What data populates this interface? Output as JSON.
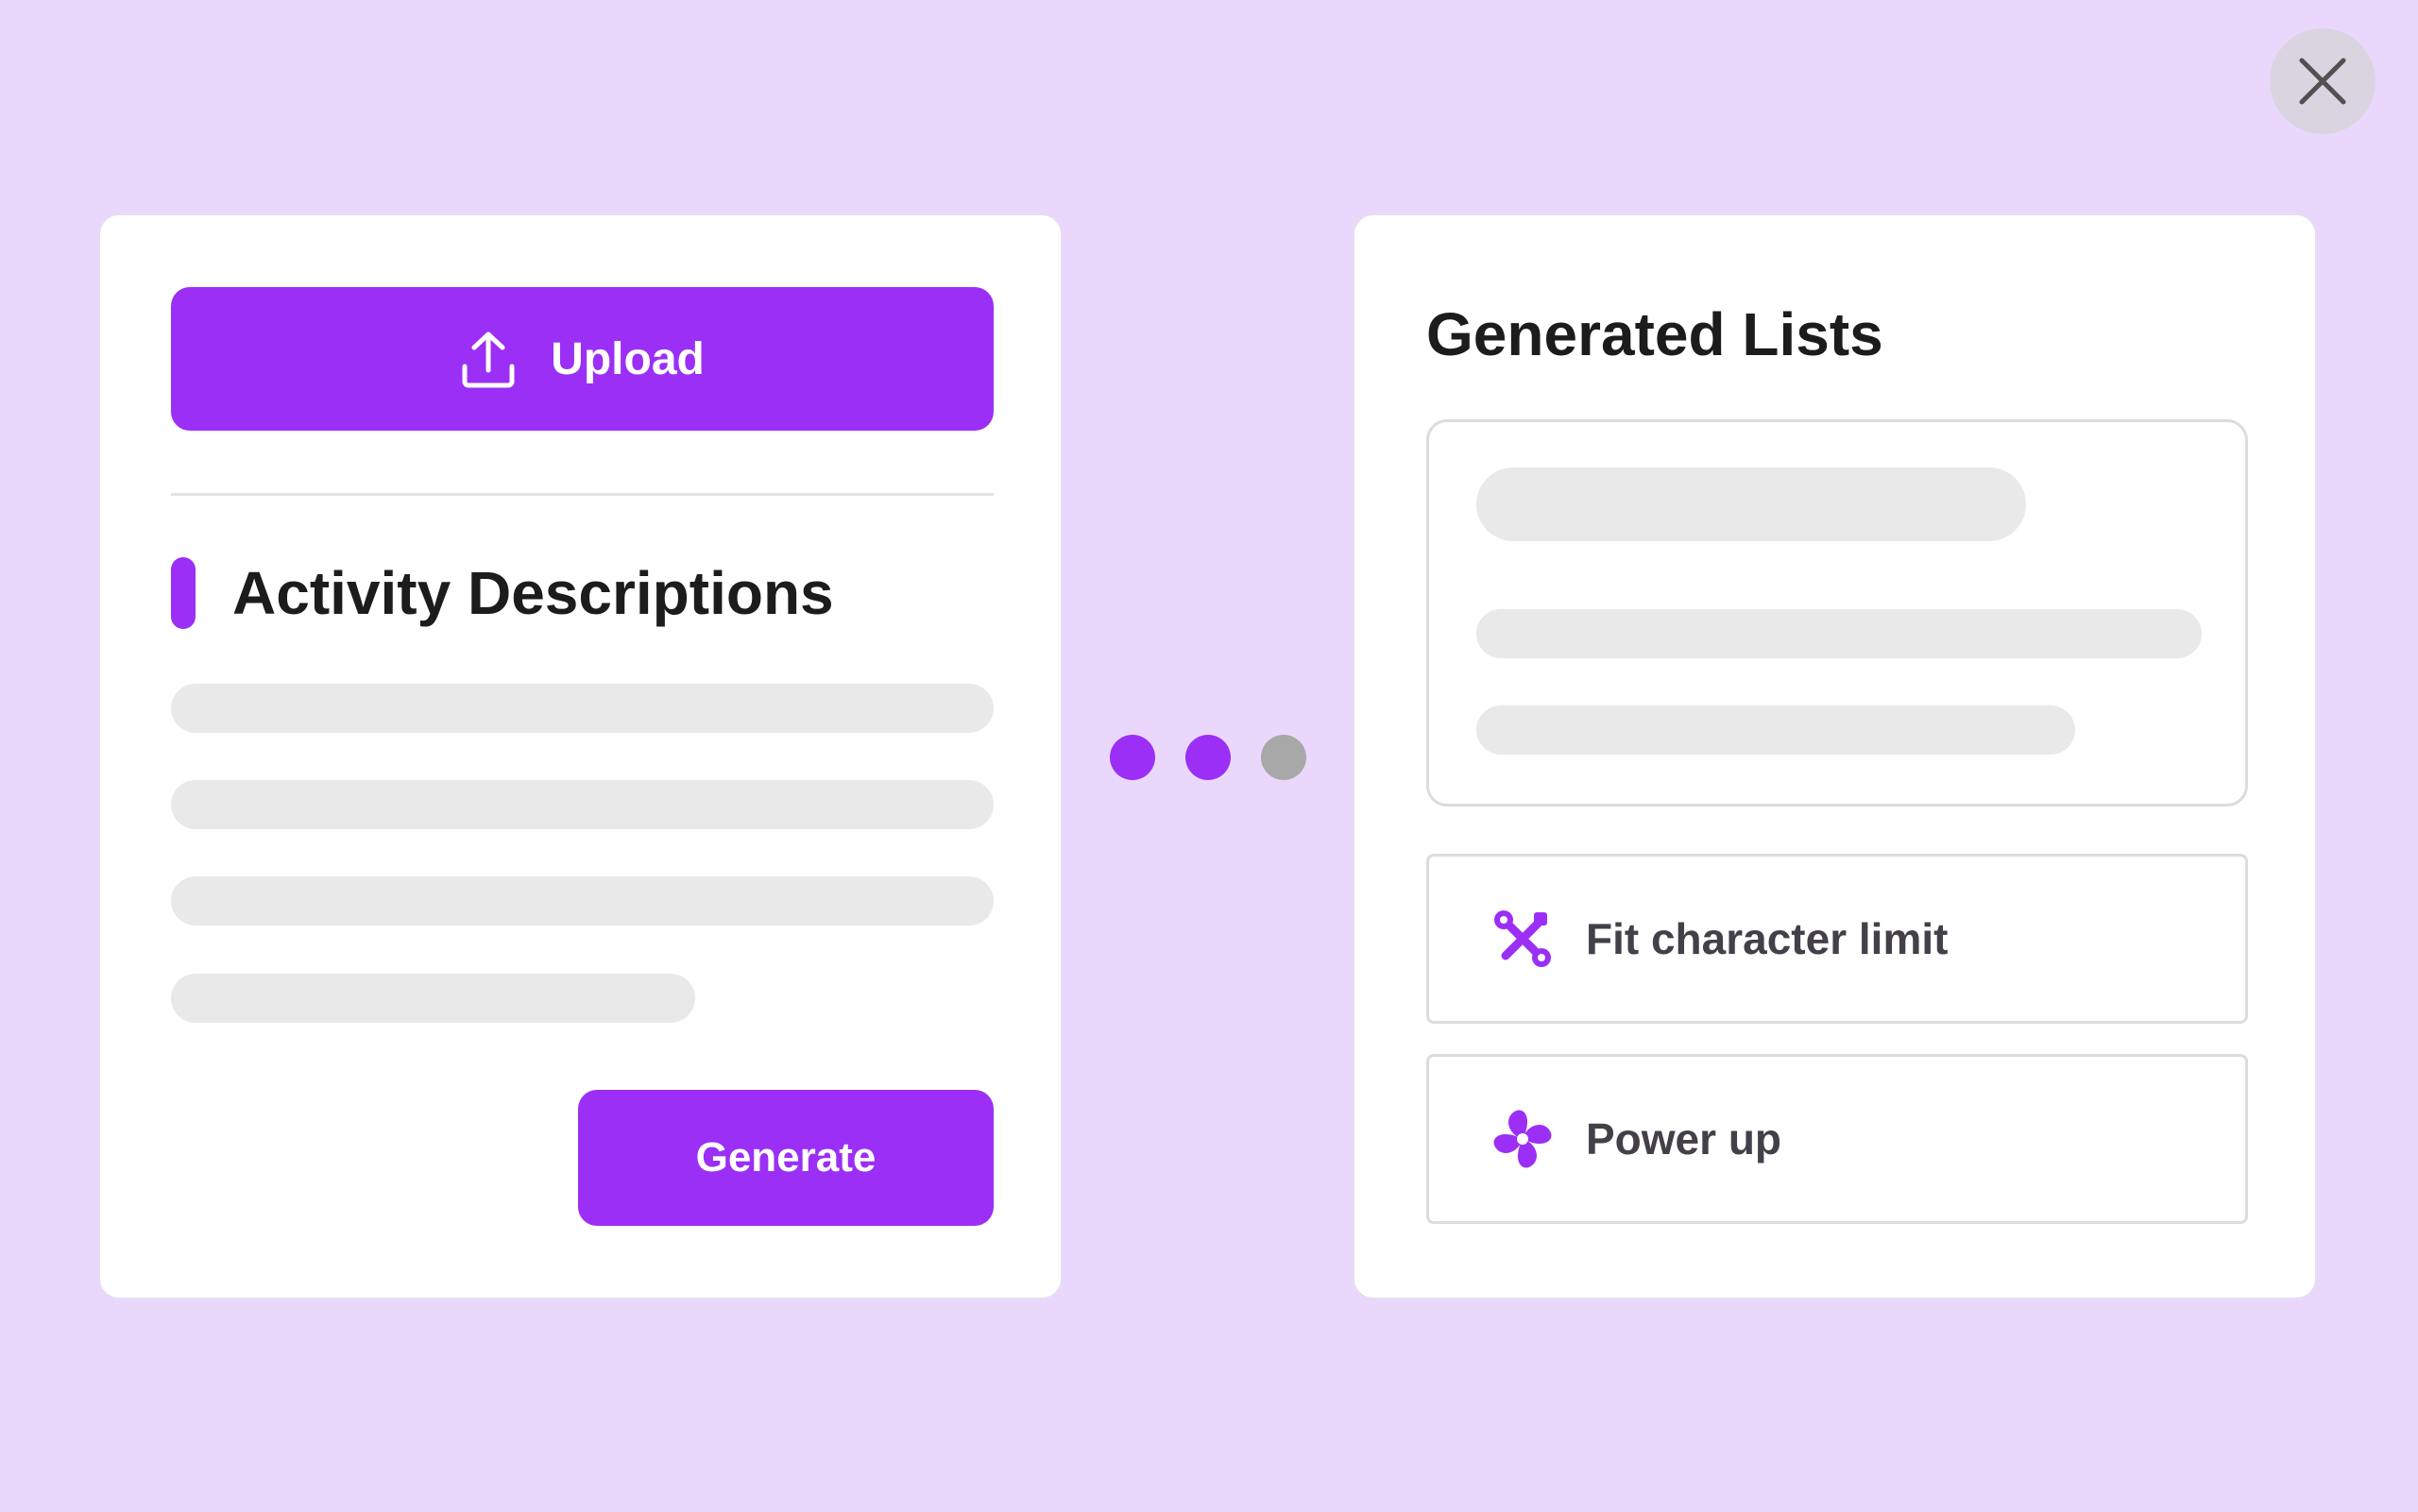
{
  "close": {
    "icon": "close-icon"
  },
  "input_panel": {
    "upload_label": "Upload",
    "upload_icon": "upload-icon",
    "section_title": "Activity Descriptions",
    "generate_label": "Generate"
  },
  "progress": {
    "step_count": 3,
    "active_steps": 2
  },
  "output_panel": {
    "title": "Generated Lists",
    "options": [
      {
        "label": "Fit character limit",
        "icon": "tools-icon"
      },
      {
        "label": "Power up",
        "icon": "pinwheel-icon"
      }
    ]
  },
  "colors": {
    "background": "#e9d8fc",
    "accent": "#9b2ff5",
    "inactive_dot": "#a8a8a8",
    "skeleton": "#e9e9e9"
  }
}
